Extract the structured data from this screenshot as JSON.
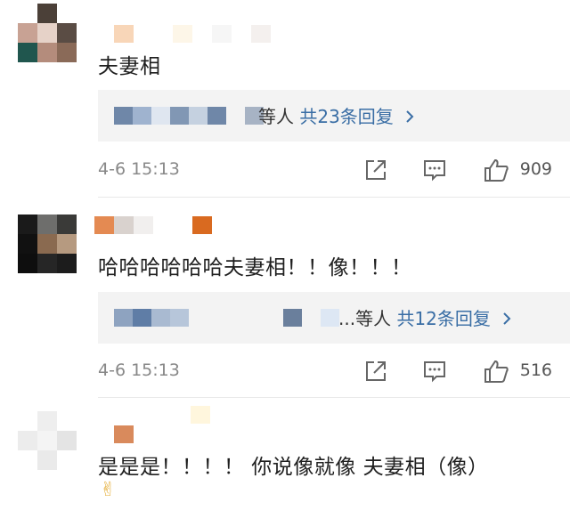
{
  "comments": [
    {
      "text": "夫妻相",
      "replies": {
        "suffix": "等人",
        "count_label": "共23条回复"
      },
      "time": "4-6 15:13",
      "likes": "909"
    },
    {
      "text": "哈哈哈哈哈哈夫妻相！！像！！！",
      "replies": {
        "suffix": "...等人",
        "count_label": "共12条回复"
      },
      "time": "4-6 15:13",
      "likes": "516"
    },
    {
      "text": "是是是！！！！ 你说像就像 夫妻相（像）",
      "emoji": "✌"
    }
  ],
  "icons": {
    "share": "share-icon",
    "comment": "comment-icon",
    "like": "thumbs-up-icon",
    "chevron": "chevron-right-icon"
  },
  "colors": {
    "reply_link": "#3a6ea5",
    "reply_bg": "#f3f3f3",
    "meta_text": "#888888"
  }
}
